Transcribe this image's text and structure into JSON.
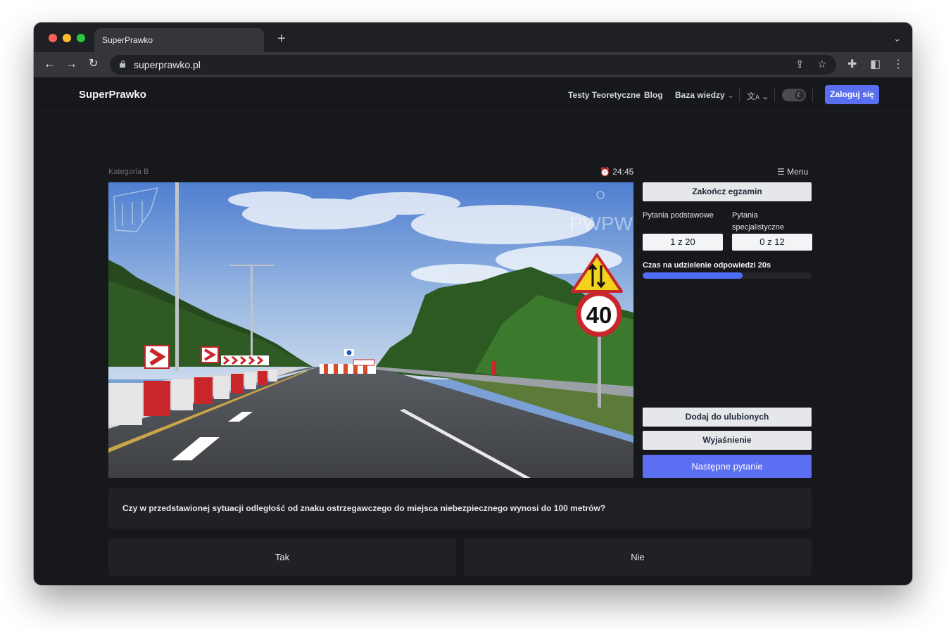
{
  "browser": {
    "tab_title": "SuperPrawko",
    "new_tab": "+",
    "url": "superprawko.pl"
  },
  "site": {
    "brand": "SuperPrawko",
    "nav": {
      "tests": "Testy Teoretyczne",
      "blog": "Blog",
      "knowledge": "Baza wiedzy",
      "login": "Zaloguj się"
    }
  },
  "exam": {
    "category": "Kategoria B",
    "timer": "24:45",
    "menu": "Menu",
    "finish_button": "Zakończ egzamin",
    "basic_label": "Pytania podstawowe",
    "basic_counter": "1 z 20",
    "special_label": "Pytania specjalistyczne",
    "special_counter": "0 z 12",
    "answer_time_label": "Czas na udzielenie odpowiedzi 20s",
    "answer_time_progress": 0.59,
    "favorite_button": "Dodaj do ulubionych",
    "explain_button": "Wyjaśnienie",
    "next_button": "Następne pytanie",
    "question": "Czy w przedstawionej sytuacji odległość od znaku ostrzegawczego do miejsca niebezpiecznego wynosi do 100 metrów?",
    "answer_yes": "Tak",
    "answer_no": "Nie"
  },
  "photo": {
    "watermark_right": "PWPW",
    "speed_limit": "40"
  },
  "colors": {
    "accent": "#5b6ff2",
    "background": "#17181b",
    "card": "#202125"
  }
}
